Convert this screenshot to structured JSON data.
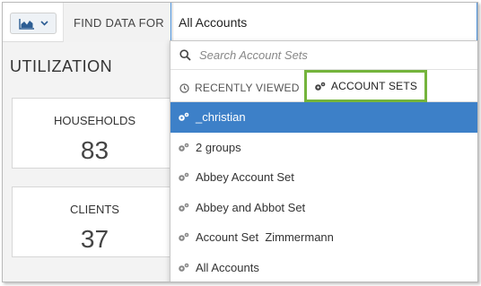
{
  "header": {
    "find_label": "FIND DATA FOR",
    "find_value": "All Accounts"
  },
  "page": {
    "title": "UTILIZATION"
  },
  "cards": [
    {
      "label": "HOUSEHOLDS",
      "value": "83"
    },
    {
      "label": "CLIENTS",
      "value": "37"
    }
  ],
  "dropdown": {
    "search_placeholder": "Search Account Sets",
    "tabs": {
      "recent": "RECENTLY VIEWED",
      "sets": "ACCOUNT SETS"
    },
    "items": [
      {
        "label": "_christian",
        "selected": true
      },
      {
        "label": "2 groups",
        "selected": false
      },
      {
        "label": "Abbey Account Set",
        "selected": false
      },
      {
        "label": "Abbey and Abbot Set",
        "selected": false
      },
      {
        "label": "Account Set  Zimmermann",
        "selected": false
      },
      {
        "label": "All Accounts",
        "selected": false
      }
    ]
  },
  "colors": {
    "accent_blue": "#3d80c8",
    "active_tab_border": "#74b43c"
  },
  "icons": {
    "chart_button": "area-chart-icon",
    "dropdown_caret": "chevron-down-icon",
    "search": "search-icon",
    "recent": "clock-icon",
    "account_set": "gears-icon"
  }
}
